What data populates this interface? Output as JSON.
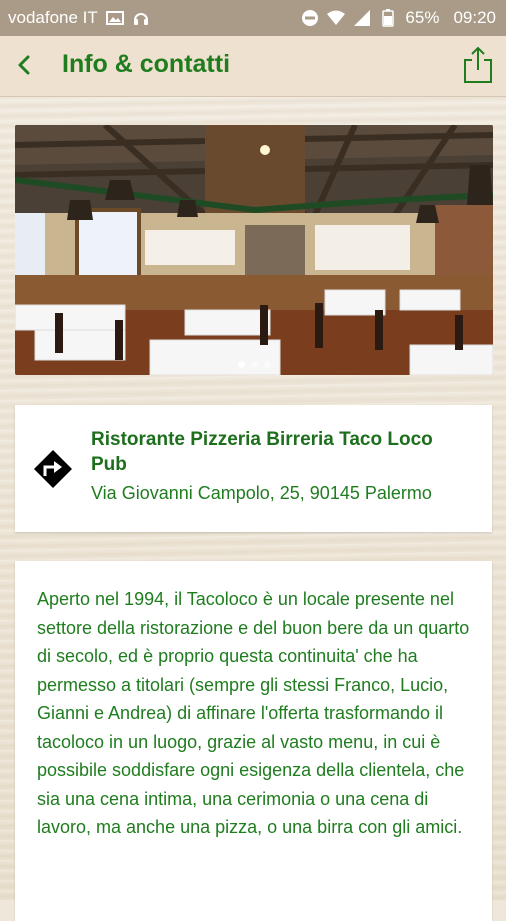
{
  "status_bar": {
    "carrier": "vodafone IT",
    "battery": "65%",
    "time": "09:20"
  },
  "app_bar": {
    "title": "Info & contatti"
  },
  "icons": {
    "back": "back-arrow-icon",
    "share": "share-icon",
    "directions": "directions-icon"
  },
  "gallery": {
    "image_description": "restaurant dining room",
    "page_count": 3,
    "active_page": 1
  },
  "place": {
    "name": "Ristorante Pizzeria Birreria Taco Loco Pub",
    "address": "Via Giovanni Campolo, 25, 90145 Palermo"
  },
  "description": "Aperto nel 1994, il Tacoloco è un locale presente nel settore della ristorazione e del buon bere da un quarto di secolo,  ed è proprio questa continuita' che ha permesso a titolari (sempre gli stessi Franco, Lucio, Gianni e Andrea) di affinare l'offerta trasformando il tacoloco in un luogo, grazie al vasto menu, in cui è possibile soddisfare ogni esigenza della clientela, che sia una cena intima, una cerimonia o una cena di lavoro, ma anche una pizza, o una birra con gli amici.",
  "colors": {
    "accent_green": "#1f7d1f",
    "status_bar": "#a99b87",
    "app_bar": "#efe1cf"
  }
}
